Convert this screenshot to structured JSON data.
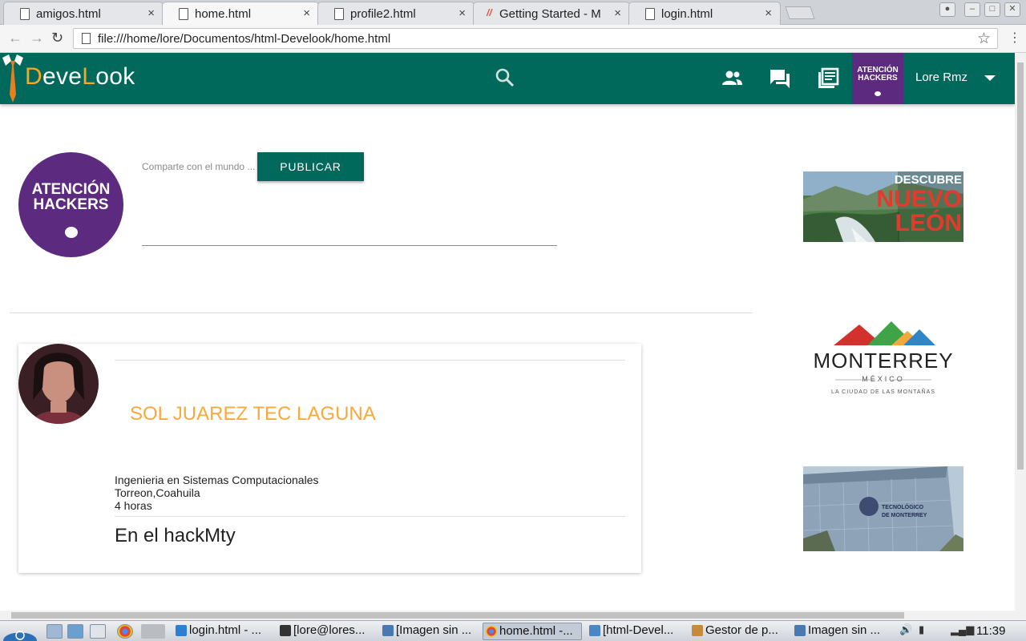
{
  "browser": {
    "tabs": [
      {
        "title": "amigos.html",
        "active": false
      },
      {
        "title": "home.html",
        "active": true
      },
      {
        "title": "profile2.html",
        "active": false
      },
      {
        "title": "Getting Started - M",
        "active": false
      },
      {
        "title": "login.html",
        "active": false
      }
    ],
    "close_glyph": "×",
    "url": "file:///home/lore/Documentos/html-Develook/home.html"
  },
  "app": {
    "brand_parts": [
      "D",
      "eve",
      "L",
      "ook"
    ],
    "brand_accent": "#f9a825",
    "primary_color": "#00695c",
    "nav_icons": [
      "search-icon",
      "friends-icon",
      "chat-icon",
      "news-icon"
    ],
    "nav_avatar_text": [
      "ATENCIÓN",
      "HACKERS"
    ],
    "user_name": "Lore Rmz"
  },
  "composer": {
    "avatar_text": [
      "ATENCIÓN",
      "HACKERS"
    ],
    "placeholder": "Comparte con el mundo ...",
    "publish_label": "PUBLICAR"
  },
  "post": {
    "author": "SOL JUAREZ TEC LAGUNA",
    "career": "Ingenieria en Sistemas Computacionales",
    "location": "Torreon,Coahuila",
    "time": "4 horas",
    "body": "En el hackMty"
  },
  "ads": {
    "ad1": [
      "DESCUBRE",
      "NUEVO",
      "LEÓN"
    ],
    "ad2": {
      "title": "MONTERREY",
      "subtitle": "MÉXICO",
      "tagline": "LA CIUDAD DE LAS MONTAÑAS"
    },
    "ad3": [
      "TECNOLÓGICO",
      "DE MONTERREY"
    ]
  },
  "taskbar": {
    "items": [
      {
        "label": "login.html - ...",
        "active": false
      },
      {
        "label": "[lore@lores...",
        "active": false
      },
      {
        "label": "[Imagen sin ...",
        "active": false
      },
      {
        "label": "home.html -...",
        "active": true
      },
      {
        "label": "[html-Devel...",
        "active": false
      },
      {
        "label": "Gestor de p...",
        "active": false
      },
      {
        "label": "Imagen sin ...",
        "active": false
      }
    ],
    "clock": "11:39"
  }
}
